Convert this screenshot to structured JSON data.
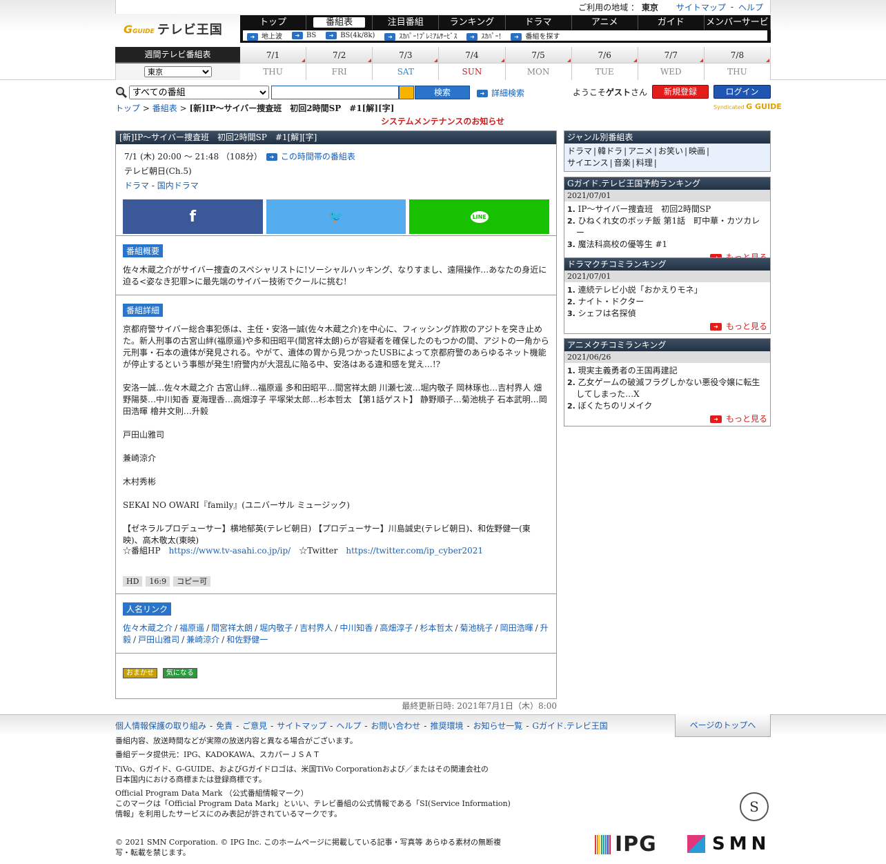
{
  "util": {
    "region_label": "ご利用の地域 ：",
    "region": "東京",
    "sitemap": "サイトマップ",
    "sep": "-",
    "help": "ヘルプ"
  },
  "logo": {
    "g": "G",
    "guide": "GUIDE",
    "title": "テレビ王国"
  },
  "nav": {
    "main": [
      "トップ",
      "番組表",
      "注目番組",
      "ランキング",
      "ドラマ",
      "アニメ",
      "ガイド",
      "メンバーサービス"
    ],
    "active": "番組表",
    "sub": [
      "地上波",
      "BS",
      "BS(4k/8k)",
      "ｽｶﾊﾟｰ!ﾌﾟﾚﾐｱﾑｻｰﾋﾞｽ",
      "ｽｶﾊﾟｰ!",
      "番組を探す"
    ]
  },
  "week": {
    "label": "週間テレビ番組表",
    "area": "東京",
    "days": [
      {
        "d": "7/1",
        "w": "THU",
        "c": "#888888"
      },
      {
        "d": "7/2",
        "w": "FRI",
        "c": "#888888"
      },
      {
        "d": "7/3",
        "w": "SAT",
        "c": "#2a8ad6"
      },
      {
        "d": "7/4",
        "w": "SUN",
        "c": "#d31a1a"
      },
      {
        "d": "7/5",
        "w": "MON",
        "c": "#888888"
      },
      {
        "d": "7/6",
        "w": "TUE",
        "c": "#888888"
      },
      {
        "d": "7/7",
        "w": "WED",
        "c": "#888888"
      },
      {
        "d": "7/8",
        "w": "THU",
        "c": "#888888"
      }
    ]
  },
  "search": {
    "scope": "すべての番組",
    "value": "",
    "button": "検索",
    "advanced": "詳細検索",
    "welcome_pre": "ようこそ",
    "guest": "ゲスト",
    "welcome_post": "さん",
    "register": "新規登録",
    "login": "ログイン"
  },
  "crumb": {
    "top": "トップ",
    "sep": ">",
    "epg": "番組表",
    "current": "[新]IP～サイバー捜査班　初回2時間SP　#1[解][字]"
  },
  "syndicated": {
    "small": "Syndicated",
    "mark": "G GUIDE"
  },
  "notice": "システムメンテナンスのお知らせ",
  "program": {
    "title": "[新]IP～サイバー捜査班　初回2時間SP　#1[解][字]",
    "time": "7/1 (木) 20:00 ～ 21:48 （108分）",
    "timeslot_link": "この時間帯の番組表",
    "channel": "テレビ朝日(Ch.5)",
    "genre1": "ドラマ",
    "genre_sep": "-",
    "genre2": "国内ドラマ",
    "share": {
      "fb": "f",
      "tw": "🐦",
      "line": "LINE"
    },
    "summary_label": "番組概要",
    "summary": "佐々木蔵之介がサイバー捜査のスペシャリストに!ソーシャルハッキング、なりすまし、遠隔操作…あなたの身近に迫る<姿なき犯罪>に最先端のサイバー技術でクールに挑む!",
    "detail_label": "番組詳細",
    "detail": [
      "京都府警サイバー総合事犯係は、主任・安洛一誠(佐々木蔵之介)を中心に、フィッシング詐欺のアジトを突き止めた。新人刑事の古宮山絆(福原遥)や多和田昭平(間宮祥太朗)らが容疑者を確保したのもつかの間、アジトの一角から元刑事・石本の遺体が発見される。やがて、遺体の胃から見つかったUSBによって京都府警のあらゆるネット機能が停止するという事態が発生!府警内が大混乱に陥る中、安洛はある違和感を覚え…!?",
      "安洛一誠…佐々木蔵之介 古宮山絆…福原遥 多和田昭平…間宮祥太朗 川瀬七波…堀内敬子 岡林琢也…吉村界人 畑野陽葵…中川知香 夏海理香…高畑淳子 平塚栄太郎…杉本哲太 【第1話ゲスト】 静野順子…菊池桃子 石本武明…岡田浩暉 檜井文則…升毅",
      "戸田山雅司",
      "兼崎涼介",
      "木村秀彬",
      "SEKAI NO OWARI『family』(ユニバーサル ミュージック)",
      "【ゼネラルプロデューサー】横地郁英(テレビ朝日) 【プロデューサー】川島誠史(テレビ朝日)、和佐野健一(東映)、高木敬太(東映)"
    ],
    "hp_label": "☆番組HP",
    "hp_url": "https://www.tv-asahi.co.jp/ip/",
    "tw_label": "☆Twitter",
    "tw_url": "https://twitter.com/ip_cyber2021",
    "tags": [
      "HD",
      "16:9",
      "コピー可"
    ],
    "people_label": "人名リンク",
    "people": [
      "佐々木蔵之介",
      "福原遥",
      "間宮祥太朗",
      "堀内敬子",
      "吉村界人",
      "中川知香",
      "高畑淳子",
      "杉本哲太",
      "菊池桃子",
      "岡田浩暉",
      "升毅",
      "戸田山雅司",
      "兼崎涼介",
      "和佐野健一"
    ],
    "people_sep": "/",
    "btn_omakase": "おまかせ",
    "btn_kininaru": "気になる",
    "updated": "最終更新日時: 2021年7月1日（木）8:00"
  },
  "side": {
    "genre_title": "ジャンル別番組表",
    "genres1": [
      "ドラマ",
      "韓ドラ",
      "アニメ",
      "お笑い",
      "映画"
    ],
    "genres2": [
      "サイエンス",
      "音楽",
      "料理"
    ],
    "genre_sep": "|",
    "rank1": {
      "title": "Gガイド.テレビ王国予約ランキング",
      "date": "2021/07/01",
      "items": [
        {
          "n": "1.",
          "t": "IP〜サイバー捜査班　初回2時間SP"
        },
        {
          "n": "2.",
          "t": "ひねくれ女のボッチ飯 第1話　町中華・カツカレー"
        },
        {
          "n": "3.",
          "t": "魔法科高校の優等生 #1"
        }
      ]
    },
    "rank2": {
      "title": "ドラマクチコミランキング",
      "date": "2021/07/01",
      "items": [
        {
          "n": "1.",
          "t": "連続テレビ小説「おかえりモネ」"
        },
        {
          "n": "2.",
          "t": "ナイト・ドクター"
        },
        {
          "n": "3.",
          "t": "シェフは名探偵"
        }
      ]
    },
    "rank3": {
      "title": "アニメクチコミランキング",
      "date": "2021/06/26",
      "items": [
        {
          "n": "1.",
          "t": "現実主義勇者の王国再建記"
        },
        {
          "n": "2.",
          "t": "乙女ゲームの破滅フラグしかない悪役令嬢に転生してしまった…X"
        },
        {
          "n": "2.",
          "t": "ぼくたちのリメイク"
        }
      ]
    },
    "more": "もっと見る"
  },
  "footer": {
    "links": [
      "個人情報保護の取り組み",
      "免責",
      "ご意見",
      "サイトマップ",
      "ヘルプ",
      "お問い合わせ",
      "推奨環境",
      "お知らせ一覧",
      "Gガイド.テレビ王国"
    ],
    "link_sep": "-",
    "totop": "ページのトップへ",
    "l1": "番組内容、放送時間などが実際の放送内容と異なる場合がございます。",
    "l2": "番組データ提供元：IPG、KADOKAWA、スカパーＪＳＡＴ",
    "l3a": "TiVo、Gガイド、G-GUIDE、およびGガイドロゴは、米国TiVo Corporationおよび／またはその関連会社の",
    "l3b": "日本国内における商標または登録商標です。",
    "l4": "Official Program Data Mark （公式番組情報マーク）",
    "l5a": "このマークは「Official Program Data Mark」といい、テレビ番組の公式情報である「SI(Service Information)",
    "l5b": "情報」を利用したサービスにのみ表記が許されているマークです。",
    "l6a": "© 2021 SMN Corporation. © IPG Inc. このホームページに掲載している記事・写真等 あらゆる素材の無断複",
    "l6b": "写・転載を禁じます。",
    "opdm_mark": "S",
    "ipg": "IPG",
    "smn": "SMN"
  }
}
